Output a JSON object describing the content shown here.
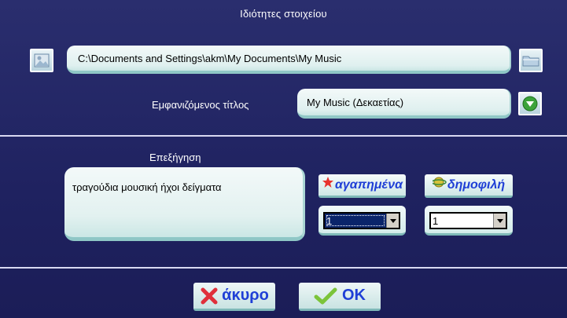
{
  "dialog": {
    "title": "Ιδιότητες στοιχείου",
    "path_value": "C:\\Documents and Settings\\akm\\My Documents\\My Music",
    "display_title_label": "Εμφανιζόμενος τίτλος",
    "display_title_value": "My Music (Δεκαετίας)",
    "description_label": "Επεξήγηση",
    "description_value": "τραγούδια μουσική ήχοι δείγματα",
    "favorites_label": "αγαπημένα",
    "favorites_select_value": "1",
    "popular_label": "δημοφιλή",
    "popular_select_value": "1",
    "cancel_label": "άκυρο",
    "ok_label": "OK"
  },
  "icons": {
    "left_image_button": "image-icon",
    "browse_folder_button": "folder-icon",
    "dropdown_button": "green-down-arrow-icon",
    "favorites_icon": "star-icon",
    "popular_icon": "planet-icon",
    "cancel_icon": "x-icon",
    "ok_icon": "check-icon"
  },
  "colors": {
    "background": "#21245f",
    "label_text": "#ffffff",
    "button_text": "#1f3fd6",
    "field_bg": "#e6f3f2",
    "cancel_x": "#e0303b",
    "ok_check": "#7cc43a"
  }
}
